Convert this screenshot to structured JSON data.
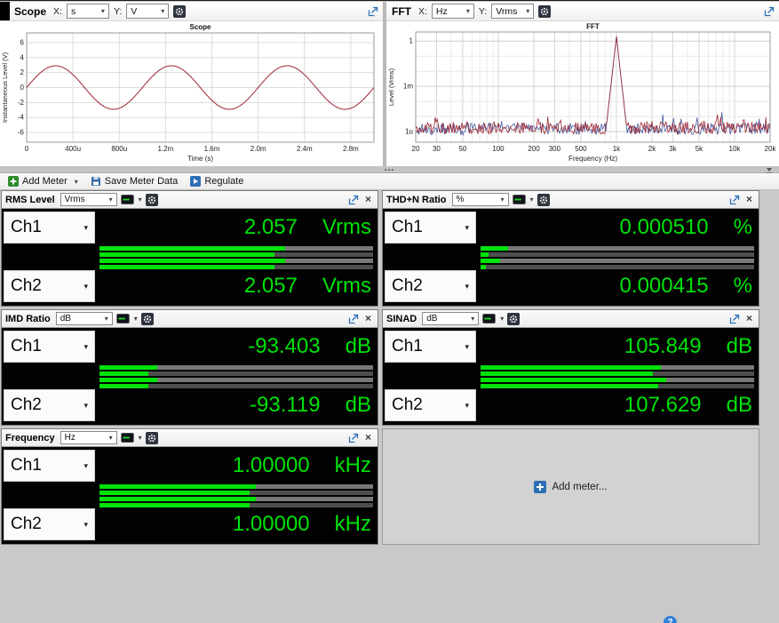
{
  "colors": {
    "green": "#00e20a",
    "accent_blue": "#2d6fb5",
    "trace_red": "#9c2732",
    "trace_blue": "#4a5a9e"
  },
  "icons": {
    "dropdown_arrow": "▾",
    "close": "×",
    "splitter_dots": "…",
    "help": "?"
  },
  "scope_panel": {
    "title": "Scope",
    "x_label": "X:",
    "x_unit": "s",
    "y_label": "Y:",
    "y_unit": "V",
    "chart_data": {
      "type": "line",
      "title": "Scope",
      "xlabel": "Time (s)",
      "ylabel": "Instantaneous Level (V)",
      "xlim": [
        0,
        0.003
      ],
      "ylim": [
        -7.3,
        7.3
      ],
      "x_tick_values": [
        0,
        0.0004,
        0.0008,
        0.0012,
        0.0016,
        0.002,
        0.0024,
        0.0028
      ],
      "x_tick_labels": [
        "0",
        "400u",
        "800u",
        "1.2m",
        "1.6m",
        "2.0m",
        "2.4m",
        "2.8m"
      ],
      "y_tick_values": [
        6,
        4,
        2,
        0,
        -2,
        -4,
        -6
      ],
      "y_tick_labels": [
        "6",
        "4",
        "2",
        "0",
        "-2",
        "-4",
        "-6"
      ],
      "grid": true,
      "signal": {
        "shape": "sine",
        "frequency_hz": 1000,
        "amplitude_v": 2.909,
        "channels": [
          "Ch1",
          "Ch2"
        ]
      },
      "trace_color": "#9c2732"
    }
  },
  "fft_panel": {
    "title": "FFT",
    "x_label": "X:",
    "x_unit": "Hz",
    "y_label": "Y:",
    "y_unit": "Vrms",
    "chart_data": {
      "type": "line",
      "x_scale": "log",
      "y_scale": "log",
      "title": "FFT",
      "xlabel": "Frequency (Hz)",
      "ylabel": "Level (Vrms)",
      "xlim": [
        20,
        20000
      ],
      "ylim": [
        2e-07,
        4
      ],
      "x_tick_values": [
        20,
        30,
        50,
        100,
        200,
        300,
        500,
        1000,
        2000,
        3000,
        5000,
        10000,
        20000
      ],
      "x_tick_labels": [
        "20",
        "30",
        "50",
        "100",
        "200",
        "300",
        "500",
        "1k",
        "2k",
        "3k",
        "5k",
        "10k",
        "20k"
      ],
      "y_tick_values": [
        1,
        0.001,
        1e-06
      ],
      "y_tick_labels": [
        "1",
        "1m",
        "1u"
      ],
      "grid": true,
      "series": [
        {
          "name": "Ch1",
          "color": "#9c2732",
          "seed": 11,
          "fundamental_hz": 1000,
          "fundamental_vrms": 2.057,
          "noise_floor_vrms": 7e-07,
          "hump": {
            "center_hz": 170,
            "vrms": 1.2e-06
          },
          "harmonics": [
            {
              "hz": 2000,
              "vrms": 5e-06
            },
            {
              "hz": 3000,
              "vrms": 3.5e-06
            },
            {
              "hz": 4000,
              "vrms": 4.5e-06
            },
            {
              "hz": 5000,
              "vrms": 3e-06
            },
            {
              "hz": 7000,
              "vrms": 5e-06
            },
            {
              "hz": 9000,
              "vrms": 3.5e-06
            },
            {
              "hz": 12000,
              "vrms": 6e-06
            },
            {
              "hz": 16000,
              "vrms": 4e-06
            }
          ]
        },
        {
          "name": "Ch2",
          "color": "#4a5a9e",
          "seed": 29,
          "fundamental_hz": 1000,
          "fundamental_vrms": 2.057,
          "noise_floor_vrms": 6e-07,
          "hump": {
            "center_hz": 120,
            "vrms": 2e-06
          },
          "harmonics": [
            {
              "hz": 2000,
              "vrms": 2e-06
            },
            {
              "hz": 3000,
              "vrms": 1.5e-06
            }
          ]
        }
      ]
    }
  },
  "toolbar": {
    "add_meter_label": "Add Meter",
    "save_label": "Save Meter Data",
    "regulate_label": "Regulate"
  },
  "meters": [
    {
      "id": "rms-level",
      "title": "RMS Level",
      "unit_combo": "Vrms",
      "channels": [
        {
          "label": "Ch1",
          "value": "2.057",
          "unit": "Vrms",
          "bars": [
            68,
            64
          ]
        },
        {
          "label": "Ch2",
          "value": "2.057",
          "unit": "Vrms",
          "bars": [
            68,
            64
          ]
        }
      ]
    },
    {
      "id": "thdn-ratio",
      "title": "THD+N Ratio",
      "unit_combo": "%",
      "channels": [
        {
          "label": "Ch1",
          "value": "0.000510",
          "unit": "%",
          "bars": [
            10,
            3
          ]
        },
        {
          "label": "Ch2",
          "value": "0.000415",
          "unit": "%",
          "bars": [
            7,
            2
          ]
        }
      ]
    },
    {
      "id": "imd-ratio",
      "title": "IMD Ratio",
      "unit_combo": "dB",
      "channels": [
        {
          "label": "Ch1",
          "value": "-93.403",
          "unit": "dB",
          "bars": [
            21,
            18
          ]
        },
        {
          "label": "Ch2",
          "value": "-93.119",
          "unit": "dB",
          "bars": [
            21,
            18
          ]
        }
      ]
    },
    {
      "id": "sinad",
      "title": "SINAD",
      "unit_combo": "dB",
      "channels": [
        {
          "label": "Ch1",
          "value": "105.849",
          "unit": "dB",
          "bars": [
            66,
            63
          ]
        },
        {
          "label": "Ch2",
          "value": "107.629",
          "unit": "dB",
          "bars": [
            68,
            65
          ]
        }
      ]
    },
    {
      "id": "frequency",
      "title": "Frequency",
      "unit_combo": "Hz",
      "channels": [
        {
          "label": "Ch1",
          "value": "1.00000",
          "unit": "kHz",
          "bars": [
            57,
            55
          ]
        },
        {
          "label": "Ch2",
          "value": "1.00000",
          "unit": "kHz",
          "bars": [
            57,
            55
          ]
        }
      ]
    }
  ],
  "add_meter": {
    "label": "Add meter..."
  }
}
